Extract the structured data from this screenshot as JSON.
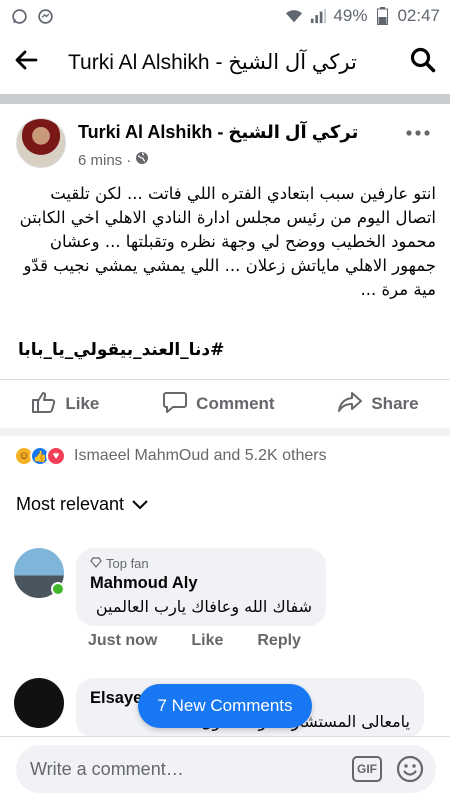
{
  "status_bar": {
    "battery_percent": "49%",
    "time": "02:47"
  },
  "header": {
    "title": "Turki Al Alshikh - تركي آل الشيخ"
  },
  "post": {
    "author": "Turki Al Alshikh - تركي آل الشيخ",
    "time": "6 mins",
    "body": "انتو عارفين سبب ابتعادي الفتره اللي فاتت ... لكن تلقيت اتصال اليوم من رئيس مجلس ادارة النادي الاهلي اخي الكابتن محمود الخطيب ووضح لي وجهة نظره وتقبلتها ... وعشان جمهور الاهلي ماياتش زعلان ... اللي يمشي يمشي نجيب قدّو مية مرة ...",
    "hashtag": "#دنا_العند_بيقولي_يا_بابا",
    "actions": {
      "like": "Like",
      "comment": "Comment",
      "share": "Share"
    },
    "reactions_text": "Ismaeel MahmOud and 5.2K others"
  },
  "comments_section": {
    "sort_label": "Most relevant",
    "comments": [
      {
        "badge": "Top fan",
        "name": "Mahmoud Aly",
        "text": "شفاك الله وعافاك يارب العالمين",
        "actions": [
          "Just now",
          "Like",
          "Reply"
        ]
      },
      {
        "name": "Elsaye",
        "text": "يامعالى المستشار ... والمسئول"
      }
    ],
    "new_comments": "7 New Comments"
  },
  "composer": {
    "placeholder": "Write a comment…",
    "gif_label": "GIF"
  },
  "colors": {
    "accent": "#1877f2",
    "muted": "#65676b",
    "bubble": "#f0f2f5"
  }
}
